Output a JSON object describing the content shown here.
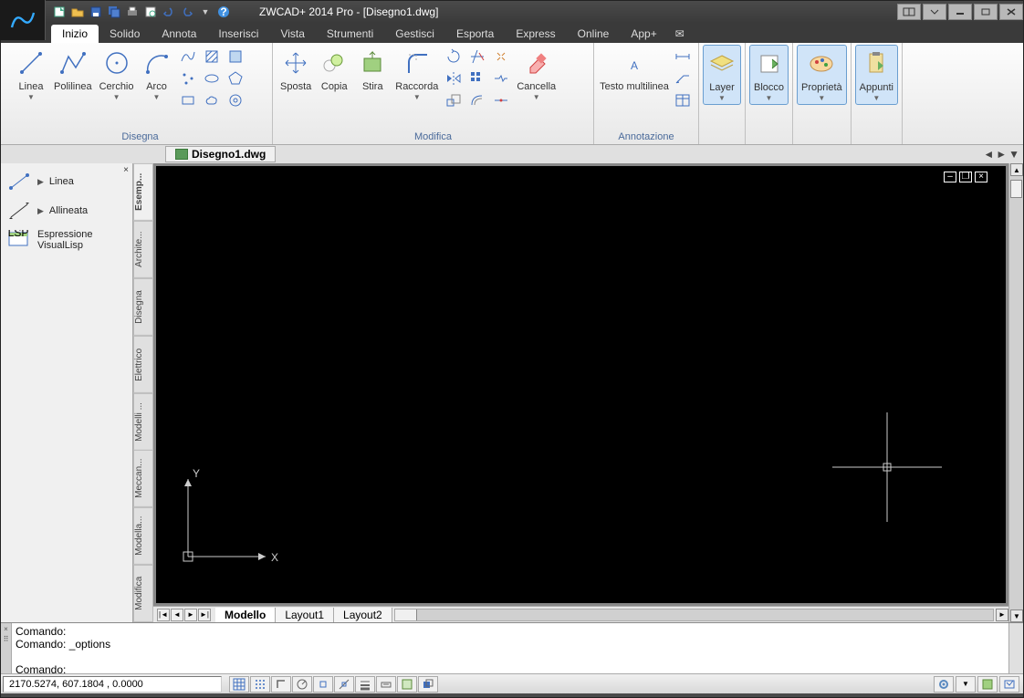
{
  "title": "ZWCAD+ 2014 Pro - [Disegno1.dwg]",
  "tabs": [
    "Inizio",
    "Solido",
    "Annota",
    "Inserisci",
    "Vista",
    "Strumenti",
    "Gestisci",
    "Esporta",
    "Express",
    "Online",
    "App+"
  ],
  "active_tab": "Inizio",
  "ribbon": {
    "groups": {
      "disegna": {
        "label": "Disegna",
        "items": [
          "Linea",
          "Polilinea",
          "Cerchio",
          "Arco"
        ]
      },
      "modifica": {
        "label": "Modifica",
        "items": [
          "Sposta",
          "Copia",
          "Stira",
          "Raccorda",
          "Cancella"
        ]
      },
      "annotazione": {
        "label": "Annotazione",
        "items": [
          "Testo\nmultilinea"
        ]
      },
      "layer": {
        "label": "Layer"
      },
      "blocco": {
        "label": "Blocco"
      },
      "proprieta": {
        "label": "Proprietà"
      },
      "appunti": {
        "label": "Appunti"
      }
    }
  },
  "doc_tab": "Disegno1.dwg",
  "sidebar": {
    "items": [
      {
        "label": "Linea"
      },
      {
        "label": "Allineata"
      },
      {
        "label": "Espressione VisualLisp"
      }
    ]
  },
  "vtabs": [
    "Esemp...",
    "Archite...",
    "Disegna",
    "Elettrico",
    "Modelli ...",
    "Meccan...",
    "Modella...",
    "Modifica"
  ],
  "layout_tabs": [
    "Modello",
    "Layout1",
    "Layout2"
  ],
  "command_lines": [
    "Comando:",
    "Comando: _options",
    "",
    "Comando:"
  ],
  "coords": "2170.5274, 607.1804 , 0.0000",
  "ucs_labels": {
    "x": "X",
    "y": "Y"
  }
}
